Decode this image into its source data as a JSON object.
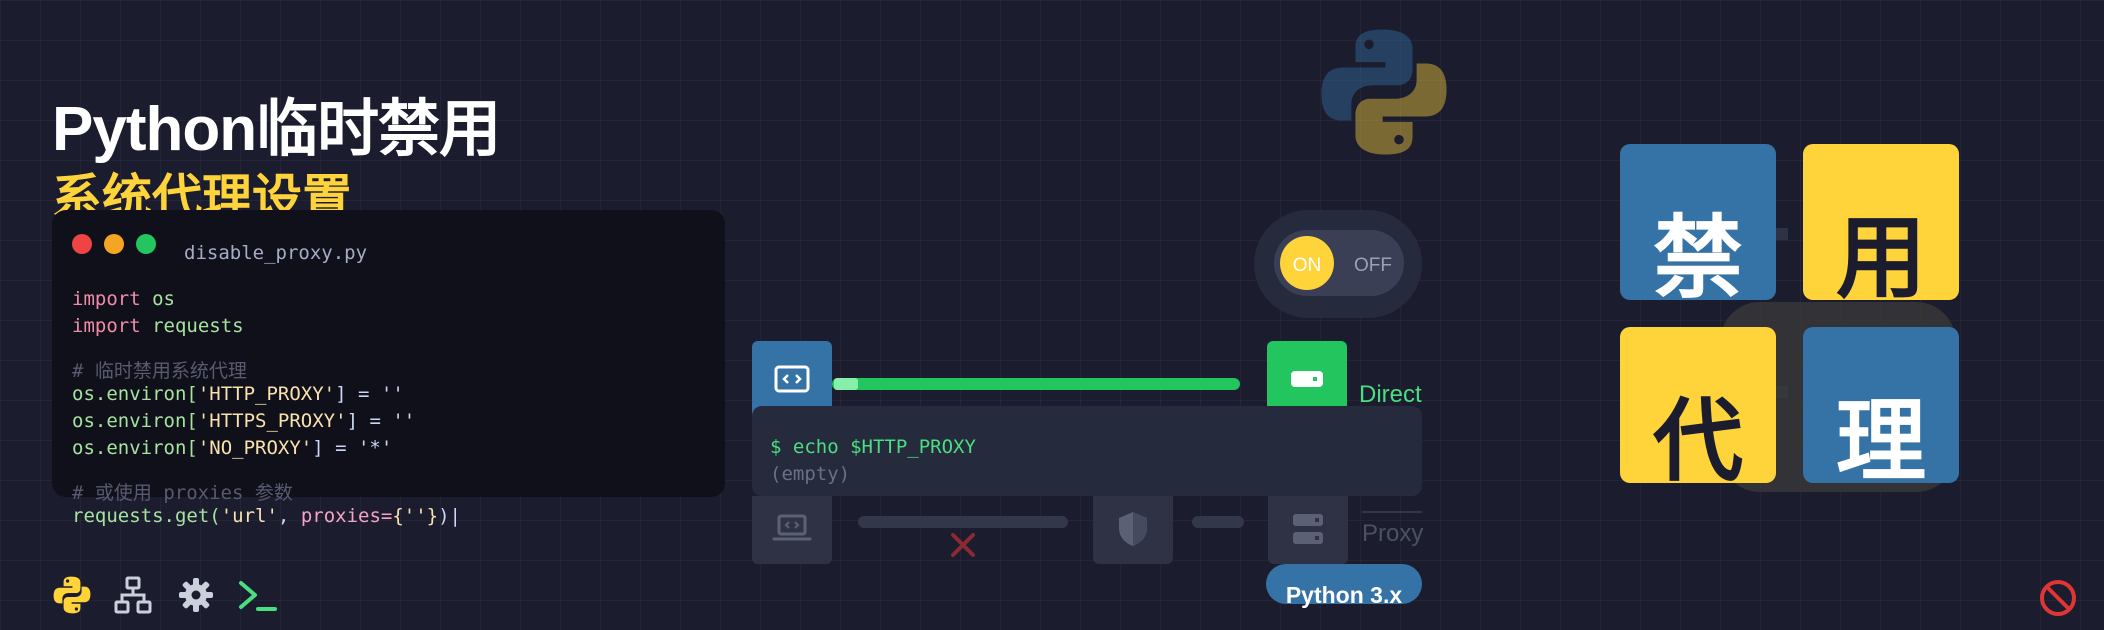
{
  "header": {
    "title": "Python临时禁用",
    "subtitle": "系统代理设置"
  },
  "code": {
    "filename": "disable_proxy.py",
    "lines": [
      {
        "kw": "import",
        "name": "os"
      },
      {
        "kw": "import",
        "name": "requests"
      },
      {
        "comment": "# 临时禁用系统代理"
      },
      {
        "obj": "os.environ[",
        "key": "'HTTP_PROXY'",
        "rest": "] = ''"
      },
      {
        "obj": "os.environ[",
        "key": "'HTTPS_PROXY'",
        "rest": "] = ''"
      },
      {
        "obj": "os.environ[",
        "key": "'NO_PROXY'",
        "rest": "] = '*'"
      },
      {
        "comment": "# 或使用 proxies 参数"
      },
      {
        "fn": "requests.get(",
        "arg": "'url'",
        "sep": ", ",
        "kwarg": "proxies=",
        "val": "{''}",
        "end": ")|"
      }
    ]
  },
  "toggle": {
    "on": "ON",
    "off": "OFF"
  },
  "terminal": {
    "command": "$ echo $HTTP_PROXY",
    "output": "(empty)"
  },
  "labels": {
    "direct": "Direct",
    "proxy": "Proxy",
    "python_version": "Python 3.x"
  },
  "tiles": [
    "禁",
    "用",
    "代",
    "理"
  ],
  "icons": {
    "python": "python-logo-icon",
    "network": "network-icon",
    "settings": "gear-icon",
    "terminal": "terminal-icon",
    "code": "code-icon",
    "server": "server-icon",
    "laptop": "laptop-code-icon",
    "shield": "shield-icon",
    "blocked": "x-icon",
    "prohibited": "ban-icon"
  },
  "colors": {
    "background": "#1b1c2e",
    "python_blue": "#3572a5",
    "python_yellow": "#ffd43b",
    "success_green": "#22c55e",
    "block_red": "#e03535"
  }
}
